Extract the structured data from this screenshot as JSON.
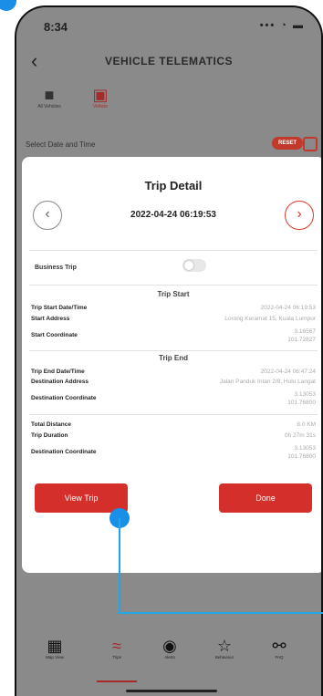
{
  "status_bar": {
    "time": "8:34",
    "indicators": "••• ◔ ▬"
  },
  "header": {
    "back_glyph": "‹",
    "title": "VEHICLE TELEMATICS"
  },
  "vehicle_tabs": [
    {
      "label": "All Vehicles",
      "icon": "car-icon"
    },
    {
      "label": "Vehicle",
      "icon": "car-selected-icon"
    }
  ],
  "selector": {
    "label": "Select Date and Time",
    "reset_label": "RESET"
  },
  "trip_detail": {
    "title": "Trip Detail",
    "datetime": "2022-04-24 06:19:53",
    "prev_glyph": "‹",
    "next_glyph": "›",
    "business_trip_label": "Business Trip",
    "trip_start": {
      "heading": "Trip Start",
      "rows": [
        {
          "label": "Trip Start Date/Time",
          "value": "2022-04-24 06:19:53"
        },
        {
          "label": "Start Address",
          "value": "Lorong Keramat 15, Kuala Lumpur"
        },
        {
          "label": "Start Coordinate",
          "value": "3.16567",
          "value2": "101.72827"
        }
      ]
    },
    "trip_end": {
      "heading": "Trip End",
      "rows": [
        {
          "label": "Trip End Date/Time",
          "value": "2022-04-24 06:47:24"
        },
        {
          "label": "Destination Address",
          "value": "Jalan Panduk Intan 2/8, Hulu Langat"
        },
        {
          "label": "Destination Coordinate",
          "value": "3.13053",
          "value2": "101.76800"
        }
      ]
    },
    "summary": [
      {
        "label": "Total Distance",
        "value": "8.0 KM"
      },
      {
        "label": "Trip Duration",
        "value": "0h 27m 31s"
      },
      {
        "label": "Destination Coordinate",
        "value": "3.13053",
        "value2": "101.76800"
      }
    ],
    "view_trip_label": "View Trip",
    "done_label": "Done"
  },
  "tabbar": [
    {
      "label": "Map View",
      "icon": "map-view-icon"
    },
    {
      "label": "Trips",
      "icon": "trips-icon"
    },
    {
      "label": "Alerts",
      "icon": "alerts-icon"
    },
    {
      "label": "Behaviour",
      "icon": "behaviour-icon"
    },
    {
      "label": "FAQ",
      "icon": "faq-icon"
    }
  ],
  "colors": {
    "accent": "#d42f2b",
    "highlight": "#1a8fe8",
    "overlay": "#8a8a8a"
  }
}
